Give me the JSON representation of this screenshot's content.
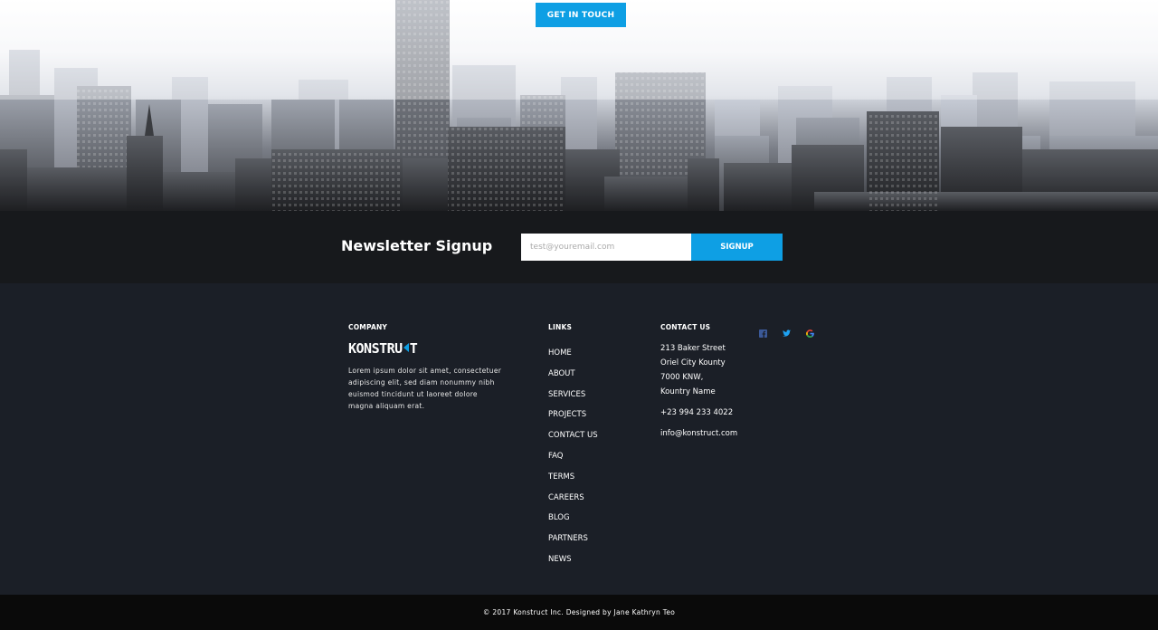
{
  "hero": {
    "cta_label": "GET IN TOUCH"
  },
  "newsletter": {
    "title": "Newsletter Signup",
    "email_placeholder": "test@youremail.com",
    "button_label": "SIGNUP"
  },
  "footer": {
    "company": {
      "heading": "COMPANY",
      "logo_prefix": "KONSTRU",
      "logo_suffix": "T",
      "about": "Lorem ipsum dolor sit amet, consectetuer adipiscing elit, sed diam nonummy nibh euismod tincidunt ut laoreet dolore magna aliquam erat."
    },
    "links": {
      "heading": "LINKS",
      "items": [
        "HOME",
        "ABOUT",
        "SERVICES",
        "PROJECTS",
        "CONTACT US",
        "FAQ",
        "TERMS",
        "CAREERS",
        "BLOG",
        "PARTNERS",
        "NEWS"
      ]
    },
    "contact": {
      "heading": "CONTACT US",
      "address": [
        "213 Baker Street",
        "Oriel City Kounty",
        "7000 KNW,",
        "Kountry Name"
      ],
      "phone": "+23 994 233 4022",
      "email": "info@konstruct.com"
    },
    "social": [
      {
        "icon": "facebook-icon",
        "glyph": "f",
        "color": "#3b5998"
      },
      {
        "icon": "twitter-icon",
        "glyph": "t",
        "color": "#1da1f2"
      },
      {
        "icon": "google-icon",
        "glyph": "G",
        "color": "#ea4335"
      }
    ]
  },
  "bottom": {
    "copyright": "© 2017 Konstruct Inc. Designed by Jane Kathryn Teo"
  },
  "colors": {
    "accent": "#0e9fe4",
    "footer_bg": "#1b1f27",
    "newsletter_bg": "#17191c",
    "bottom_bg": "#0a0a0a"
  }
}
